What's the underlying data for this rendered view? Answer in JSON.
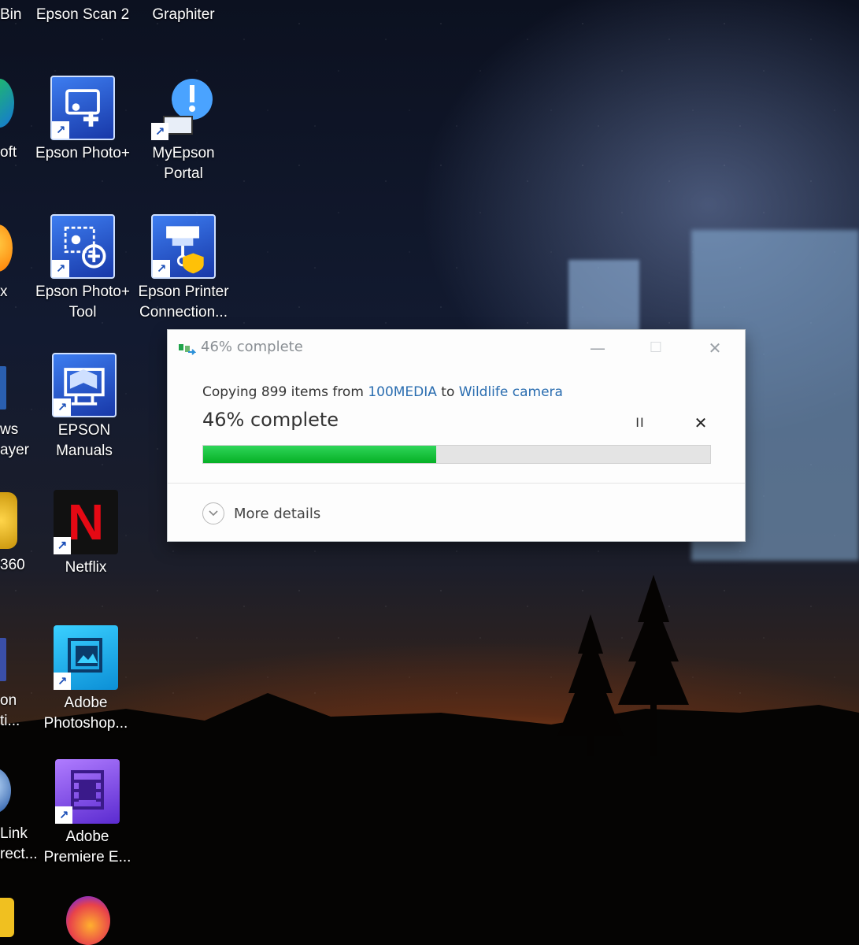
{
  "desktop": {
    "edge_labels": [
      "Bin",
      "oft",
      "x",
      "ws",
      "ayer",
      "360",
      "on",
      "ti...",
      "Link",
      "rect..."
    ],
    "icons": [
      {
        "label": "Epson Scan 2"
      },
      {
        "label": "Graphiter"
      },
      {
        "label": "Epson Photo+",
        "shortcut_glyph": "↗"
      },
      {
        "label": "MyEpson Portal",
        "shortcut_glyph": "↗"
      },
      {
        "label": "Epson Photo+ Tool",
        "shortcut_glyph": "↗"
      },
      {
        "label": "Epson Printer Connection...",
        "shortcut_glyph": "↗"
      },
      {
        "label": "EPSON Manuals",
        "shortcut_glyph": "↗"
      },
      {
        "label": "Netflix",
        "glyph": "N",
        "shortcut_glyph": "↗"
      },
      {
        "label": "Adobe Photoshop...",
        "shortcut_glyph": "↗"
      },
      {
        "label": "Adobe Premiere E...",
        "shortcut_glyph": "↗"
      }
    ]
  },
  "dialog": {
    "title": "46% complete",
    "window_buttons": {
      "minimize": "—",
      "maximize": "☐",
      "close": "✕"
    },
    "status": {
      "prefix": "Copying 899 items from ",
      "source": "100MEDIA",
      "middle": " to ",
      "destination": "Wildlife camera"
    },
    "percent_text": "46% complete",
    "progress": 0.46,
    "pause_glyph": "II",
    "cancel_glyph": "✕",
    "more_details_label": "More details",
    "colors": {
      "progress_fill": "#06b025",
      "link": "#2a6db0"
    }
  }
}
